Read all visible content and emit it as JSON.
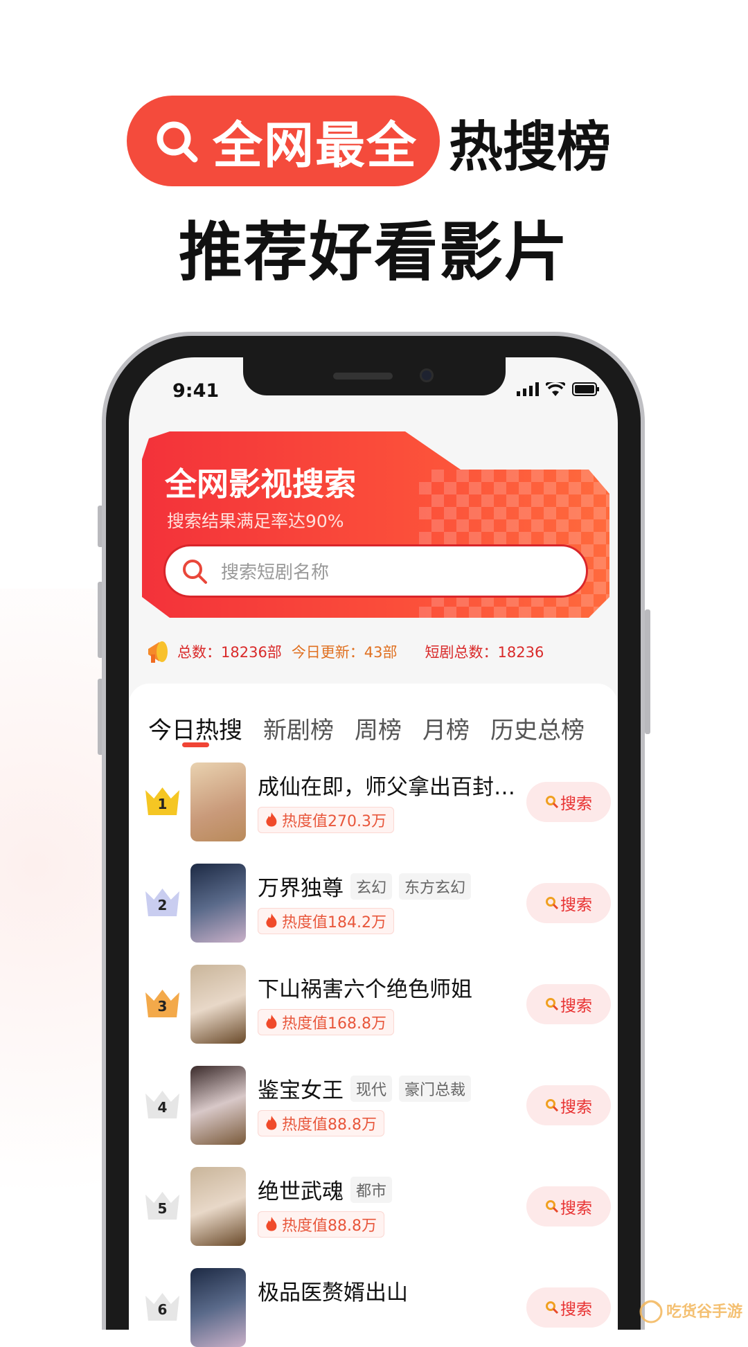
{
  "headline": {
    "pill_text": "全网最全",
    "title_suffix": "热搜榜",
    "subtitle": "推荐好看影片"
  },
  "status_bar": {
    "time": "9:41"
  },
  "banner": {
    "title": "全网影视搜索",
    "subtitle": "搜索结果满足率达90%",
    "search_placeholder": "搜索短剧名称"
  },
  "ticker": {
    "items": [
      "总数：18236部",
      "今日更新：43部",
      "短剧总数：18236"
    ]
  },
  "tabs": [
    {
      "label": "今日热搜",
      "active": true
    },
    {
      "label": "新剧榜"
    },
    {
      "label": "周榜"
    },
    {
      "label": "月榜"
    },
    {
      "label": "历史总榜"
    }
  ],
  "search_button_label": "搜索",
  "rankings": [
    {
      "rank": "1",
      "title": "成仙在即，师父拿出百封…",
      "tags": [],
      "heat": "热度值270.3万",
      "crown_color": "#f5c623"
    },
    {
      "rank": "2",
      "title": "万界独尊",
      "tags": [
        "玄幻",
        "东方玄幻"
      ],
      "heat": "热度值184.2万",
      "crown_color": "#c9cdf0"
    },
    {
      "rank": "3",
      "title": "下山祸害六个绝色师姐",
      "tags": [],
      "heat": "热度值168.8万",
      "crown_color": "#f3a94a"
    },
    {
      "rank": "4",
      "title": "鉴宝女王",
      "tags": [
        "现代",
        "豪门总裁"
      ],
      "heat": "热度值88.8万",
      "crown_color": "#e6e6e6"
    },
    {
      "rank": "5",
      "title": "绝世武魂",
      "tags": [
        "都市"
      ],
      "heat": "热度值88.8万",
      "crown_color": "#e6e6e6"
    },
    {
      "rank": "6",
      "title": "极品医赘婿出山",
      "tags": [],
      "heat": "",
      "crown_color": "#e6e6e6"
    }
  ],
  "watermark": "吃货谷手游",
  "colors": {
    "accent": "#f44b3c",
    "heat": "#e8563b"
  }
}
